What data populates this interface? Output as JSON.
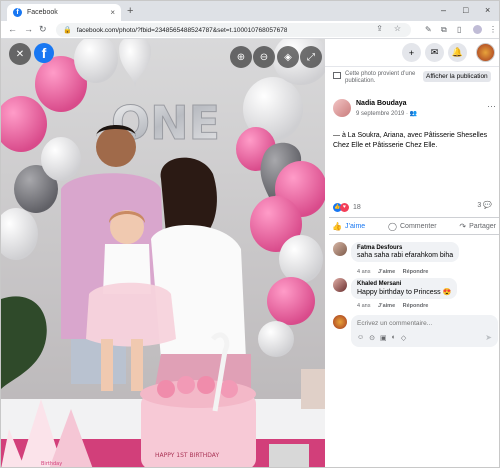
{
  "browser": {
    "tab_title": "Facebook",
    "tab_close": "×",
    "new_tab": "+",
    "url": "facebook.com/photo/?fbid=2348565488524787&set=t.100010768057678",
    "controls": {
      "minimize": "–",
      "maximize": "□",
      "close": "×"
    }
  },
  "photo_viewer": {
    "close_glyph": "✕",
    "logo_glyph": "f",
    "zoom_in_glyph": "⊕",
    "zoom_out_glyph": "⊖",
    "tag_glyph": "◈",
    "fullscreen_glyph": "⤢",
    "balloon_text": "ONE",
    "cake_text": "HAPPY 1ST BIRTHDAY",
    "hat_text": "Birthday"
  },
  "topbar": {
    "add_glyph": "+",
    "messenger_glyph": "✉",
    "bell_glyph": "🔔"
  },
  "page_link": {
    "text": "Cette photo provient d’une publication.",
    "button": "Afficher la publication"
  },
  "post": {
    "author": "Nadia Boudaya",
    "date": "9 septembre 2019 · ",
    "globe": "👥",
    "more": "···",
    "text": "— à La Soukra, Ariana, avec Pâtisserie Sheselles Chez Elle et Pâtisserie Chez Elle.",
    "reaction_count": "18",
    "comment_count": "3"
  },
  "actions": {
    "like": "J’aime",
    "comment": "Commenter",
    "share": "Partager"
  },
  "comments": [
    {
      "name": "Fatma Desfours",
      "text": "saha saha rabi efarahkom biha",
      "time": "4 ans",
      "like": "J’aime",
      "reply": "Répondre"
    },
    {
      "name": "Khaled Mersani",
      "text": "Happy birthday to Princess 😍",
      "time": "4 ans",
      "like": "J’aime",
      "reply": "Répondre"
    }
  ],
  "compose": {
    "placeholder": "Écrivez un commentaire...",
    "icons": [
      "☺",
      "⊙",
      "▣",
      "◐",
      "◇"
    ],
    "send": "➤"
  },
  "colors": {
    "accent": "#1877f2",
    "love": "#f33e58",
    "balloon_pink": "#e75a96"
  }
}
